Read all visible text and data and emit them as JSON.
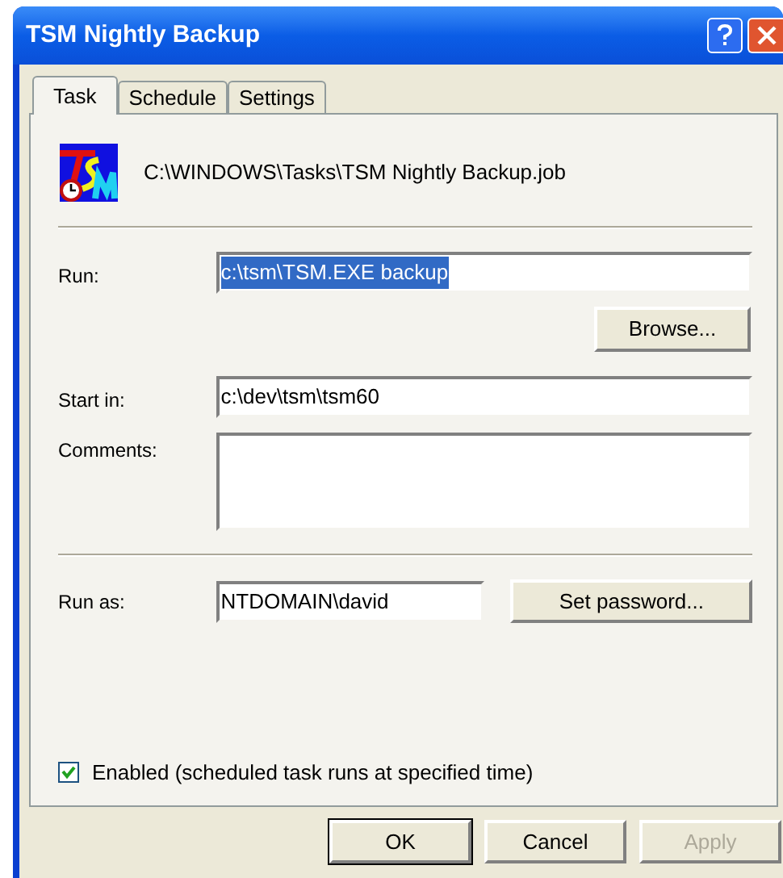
{
  "window": {
    "title": "TSM Nightly Backup"
  },
  "tabs": [
    {
      "label": "Task",
      "selected": true
    },
    {
      "label": "Schedule",
      "selected": false
    },
    {
      "label": "Settings",
      "selected": false
    }
  ],
  "task_file": {
    "path": "C:\\WINDOWS\\Tasks\\TSM Nightly Backup.job"
  },
  "run": {
    "label": "Run:",
    "value": "c:\\tsm\\TSM.EXE backup",
    "text_selected": true
  },
  "browse_button": {
    "label": "Browse..."
  },
  "start_in": {
    "label": "Start in:",
    "value": "c:\\dev\\tsm\\tsm60"
  },
  "comments": {
    "label": "Comments:"
  },
  "run_as": {
    "label": "Run as:",
    "value": "NTDOMAIN\\david"
  },
  "set_password_button": {
    "label": "Set password..."
  },
  "enabled": {
    "label": "Enabled (scheduled task runs at specified time)",
    "checked": true
  },
  "buttons": [
    {
      "label": "OK",
      "default": true,
      "disabled": false
    },
    {
      "label": "Cancel",
      "default": false,
      "disabled": false
    },
    {
      "label": "Apply",
      "default": false,
      "disabled": true
    }
  ]
}
